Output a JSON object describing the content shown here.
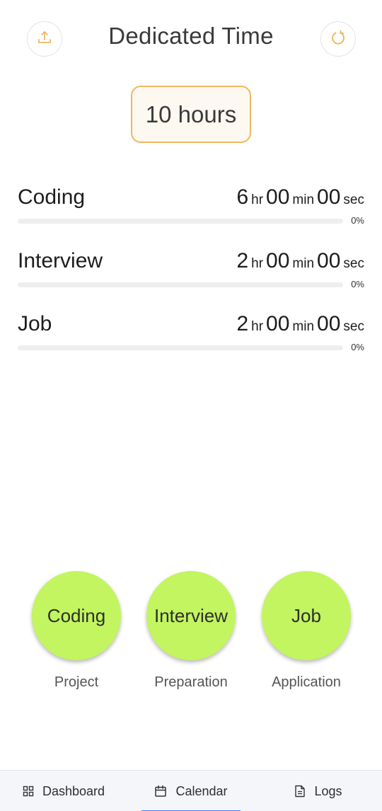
{
  "header": {
    "title": "Dedicated Time",
    "upload_icon": "upload-icon",
    "reset_icon": "refresh-icon"
  },
  "total": {
    "label": "10 hours"
  },
  "rows": [
    {
      "label": "Coding",
      "hr": "6",
      "min": "00",
      "sec": "00",
      "unit_hr": "hr",
      "unit_min": "min",
      "unit_sec": "sec",
      "percent_text": "0%",
      "progress": 0
    },
    {
      "label": "Interview",
      "hr": "2",
      "min": "00",
      "sec": "00",
      "unit_hr": "hr",
      "unit_min": "min",
      "unit_sec": "sec",
      "percent_text": "0%",
      "progress": 0
    },
    {
      "label": "Job",
      "hr": "2",
      "min": "00",
      "sec": "00",
      "unit_hr": "hr",
      "unit_min": "min",
      "unit_sec": "sec",
      "percent_text": "0%",
      "progress": 0
    }
  ],
  "activities": [
    {
      "circle_label": "Coding",
      "caption": "Project"
    },
    {
      "circle_label": "Interview",
      "caption": "Preparation"
    },
    {
      "circle_label": "Job",
      "caption": "Application"
    }
  ],
  "nav": {
    "items": [
      {
        "label": "Dashboard",
        "icon": "grid-icon"
      },
      {
        "label": "Calendar",
        "icon": "calendar-icon",
        "active": true
      },
      {
        "label": "Logs",
        "icon": "document-icon"
      }
    ]
  },
  "colors": {
    "accent": "#f0b860",
    "activity_green": "#c2f55f",
    "nav_active": "#3b82f6"
  }
}
